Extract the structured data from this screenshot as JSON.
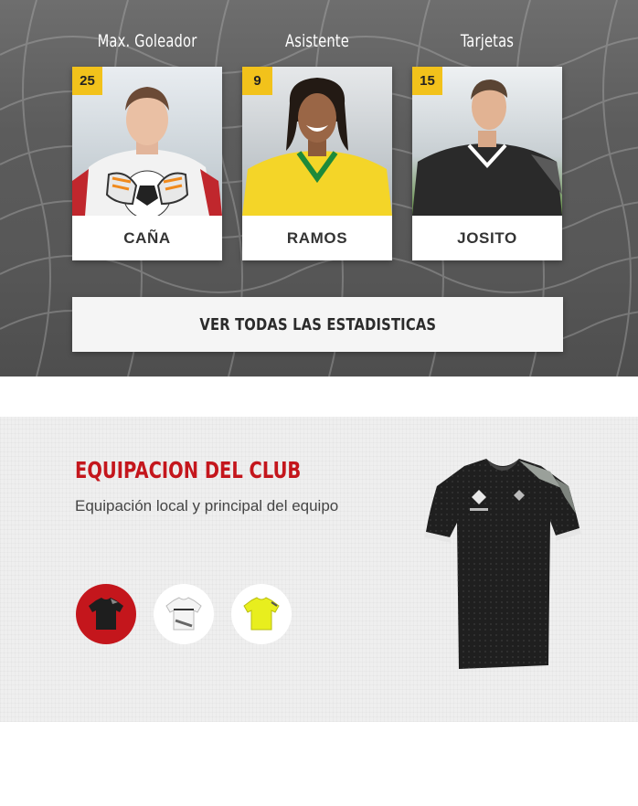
{
  "stats": {
    "columns": [
      {
        "title": "Max. Goleador",
        "value": "25",
        "player": "CAÑA"
      },
      {
        "title": "Asistente",
        "value": "9",
        "player": "RAMOS"
      },
      {
        "title": "Tarjetas",
        "value": "15",
        "player": "JOSITO"
      }
    ],
    "button_label": "VER TODAS LAS ESTADISTICAS"
  },
  "kit": {
    "title": "EQUIPACION DEL CLUB",
    "subtitle": "Equipación local y principal del equipo",
    "swatches": [
      {
        "name": "black-red",
        "selected": true
      },
      {
        "name": "white"
      },
      {
        "name": "yellow"
      }
    ]
  },
  "colors": {
    "accent_red": "#c4161c",
    "badge_yellow": "#f2c21b"
  }
}
